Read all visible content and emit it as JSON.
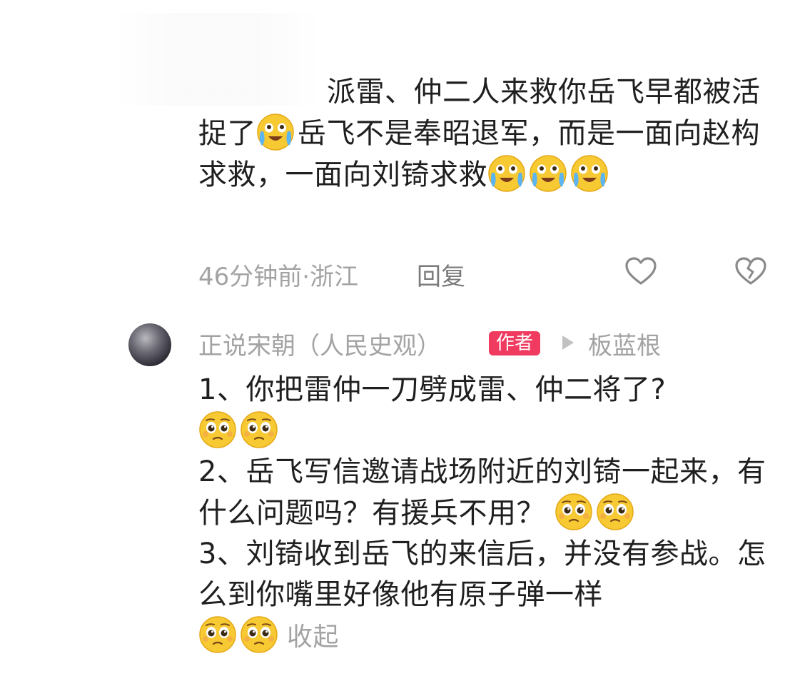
{
  "reply": {
    "text_part1": "派雷、仲二人来救你岳飞早都被活捉了",
    "text_part2": "岳飞不是奉昭退军，而是一面向赵构求救，一面向刘锜求救",
    "time_location": "46分钟前·浙江",
    "reply_label": "回复"
  },
  "author_comment": {
    "author_name": "正说宋朝（人民史观）",
    "badge": "作者",
    "reply_to": "板蓝根",
    "line1": "1、你把雷仲一刀劈成雷、仲二将了?",
    "line2": "2、岳飞写信邀请战场附近的刘锜一起来，有什么问题吗？有援兵不用？",
    "line3": "3、刘锜收到岳飞的来信后，并没有参战。怎么到你嘴里好像他有原子弹一样",
    "collapse_label": "收起"
  },
  "icons": {
    "like": "heart-outline-icon",
    "dislike": "broken-heart-outline-icon",
    "emoji_crying": "crying-face-emoji",
    "emoji_pleading": "pleading-face-emoji"
  },
  "colors": {
    "badge_bg": "#f03a5f",
    "meta_text": "#a3a3a3",
    "body_text": "#1f1f1f"
  }
}
